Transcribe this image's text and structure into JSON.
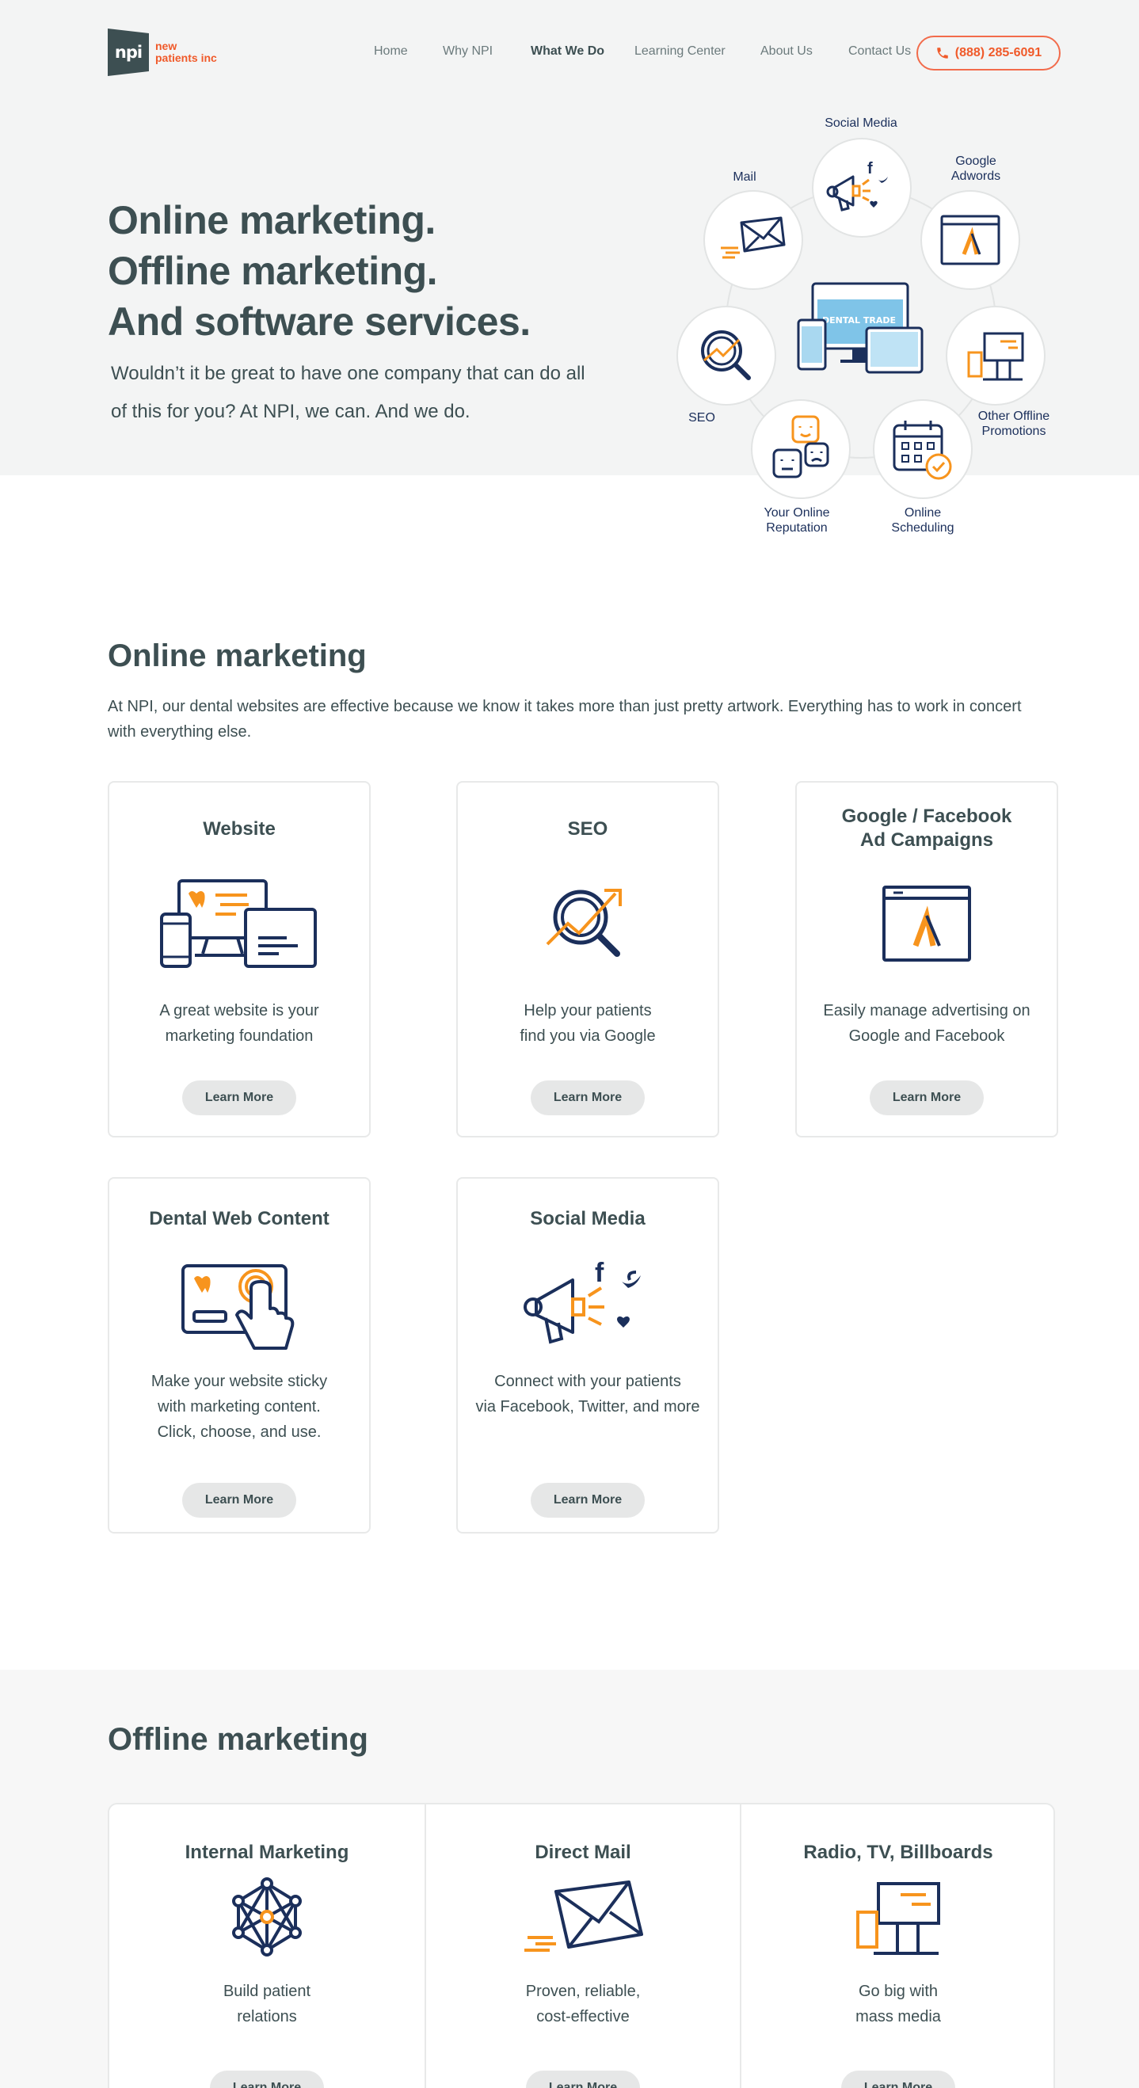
{
  "brand": {
    "logo_mark": "npi",
    "logo_line1": "new",
    "logo_line2": "patients inc"
  },
  "nav": {
    "items": [
      "Home",
      "Why NPI",
      "What We Do",
      "Learning Center",
      "About Us",
      "Contact Us"
    ],
    "active": "What We Do",
    "phone": "(888) 285-6091"
  },
  "hero": {
    "title_lines": [
      "Online marketing.",
      "Offline marketing.",
      "And software services."
    ],
    "subtitle": "Wouldn’t it be great to have one company that can do all of this for you? At NPI, we can. And we do."
  },
  "diagram": {
    "social": "Social Media",
    "mail": "Mail",
    "adwords_1": "Google",
    "adwords_2": "Adwords",
    "seo": "SEO",
    "offline_1": "Other Offline",
    "offline_2": "Promotions",
    "reputation_1": "Your Online",
    "reputation_2": "Reputation",
    "scheduling_1": "Online",
    "scheduling_2": "Scheduling",
    "screen_text": "DENTAL TRADE"
  },
  "online": {
    "title": "Online marketing",
    "description": "At NPI,  our dental websites are effective because we know it takes more than just pretty artwork. Everything has to work in concert with everything else.",
    "cards": [
      {
        "title": "Website",
        "text1": "A great website is your",
        "text2": "marketing foundation",
        "button": "Learn More",
        "icon": "website-icon"
      },
      {
        "title": "SEO",
        "text1": "Help your patients",
        "text2": "find you via Google",
        "button": "Learn More",
        "icon": "seo-icon"
      },
      {
        "title_1": "Google / Facebook",
        "title_2": "Ad Campaigns",
        "text1": "Easily manage advertising on",
        "text2": "Google and Facebook",
        "button": "Learn More",
        "icon": "ads-icon"
      },
      {
        "title": "Dental Web Content",
        "text1": "Make your website sticky",
        "text2": "with marketing content.",
        "text3": "Click, choose, and use.",
        "button": "Learn More",
        "icon": "content-icon"
      },
      {
        "title": "Social Media",
        "text1": "Connect with your patients",
        "text2": "via Facebook, Twitter, and more",
        "button": "Learn More",
        "icon": "megaphone-icon"
      }
    ]
  },
  "offline": {
    "title": "Offline marketing",
    "cards": [
      {
        "title": "Internal Marketing",
        "text1": "Build patient",
        "text2": "relations",
        "button": "Learn More",
        "icon": "network-icon"
      },
      {
        "title": "Direct Mail",
        "text1": "Proven, reliable,",
        "text2": "cost-effective",
        "button": "Learn More",
        "icon": "mail-icon"
      },
      {
        "title": "Radio, TV, Billboards",
        "text1": "Go big with",
        "text2": "mass media",
        "button": "Learn More",
        "icon": "billboard-icon"
      }
    ]
  },
  "colors": {
    "navy": "#1b2f5b",
    "orange": "#f7941d",
    "slate": "#3d4f52",
    "accent": "#f05a2a"
  }
}
